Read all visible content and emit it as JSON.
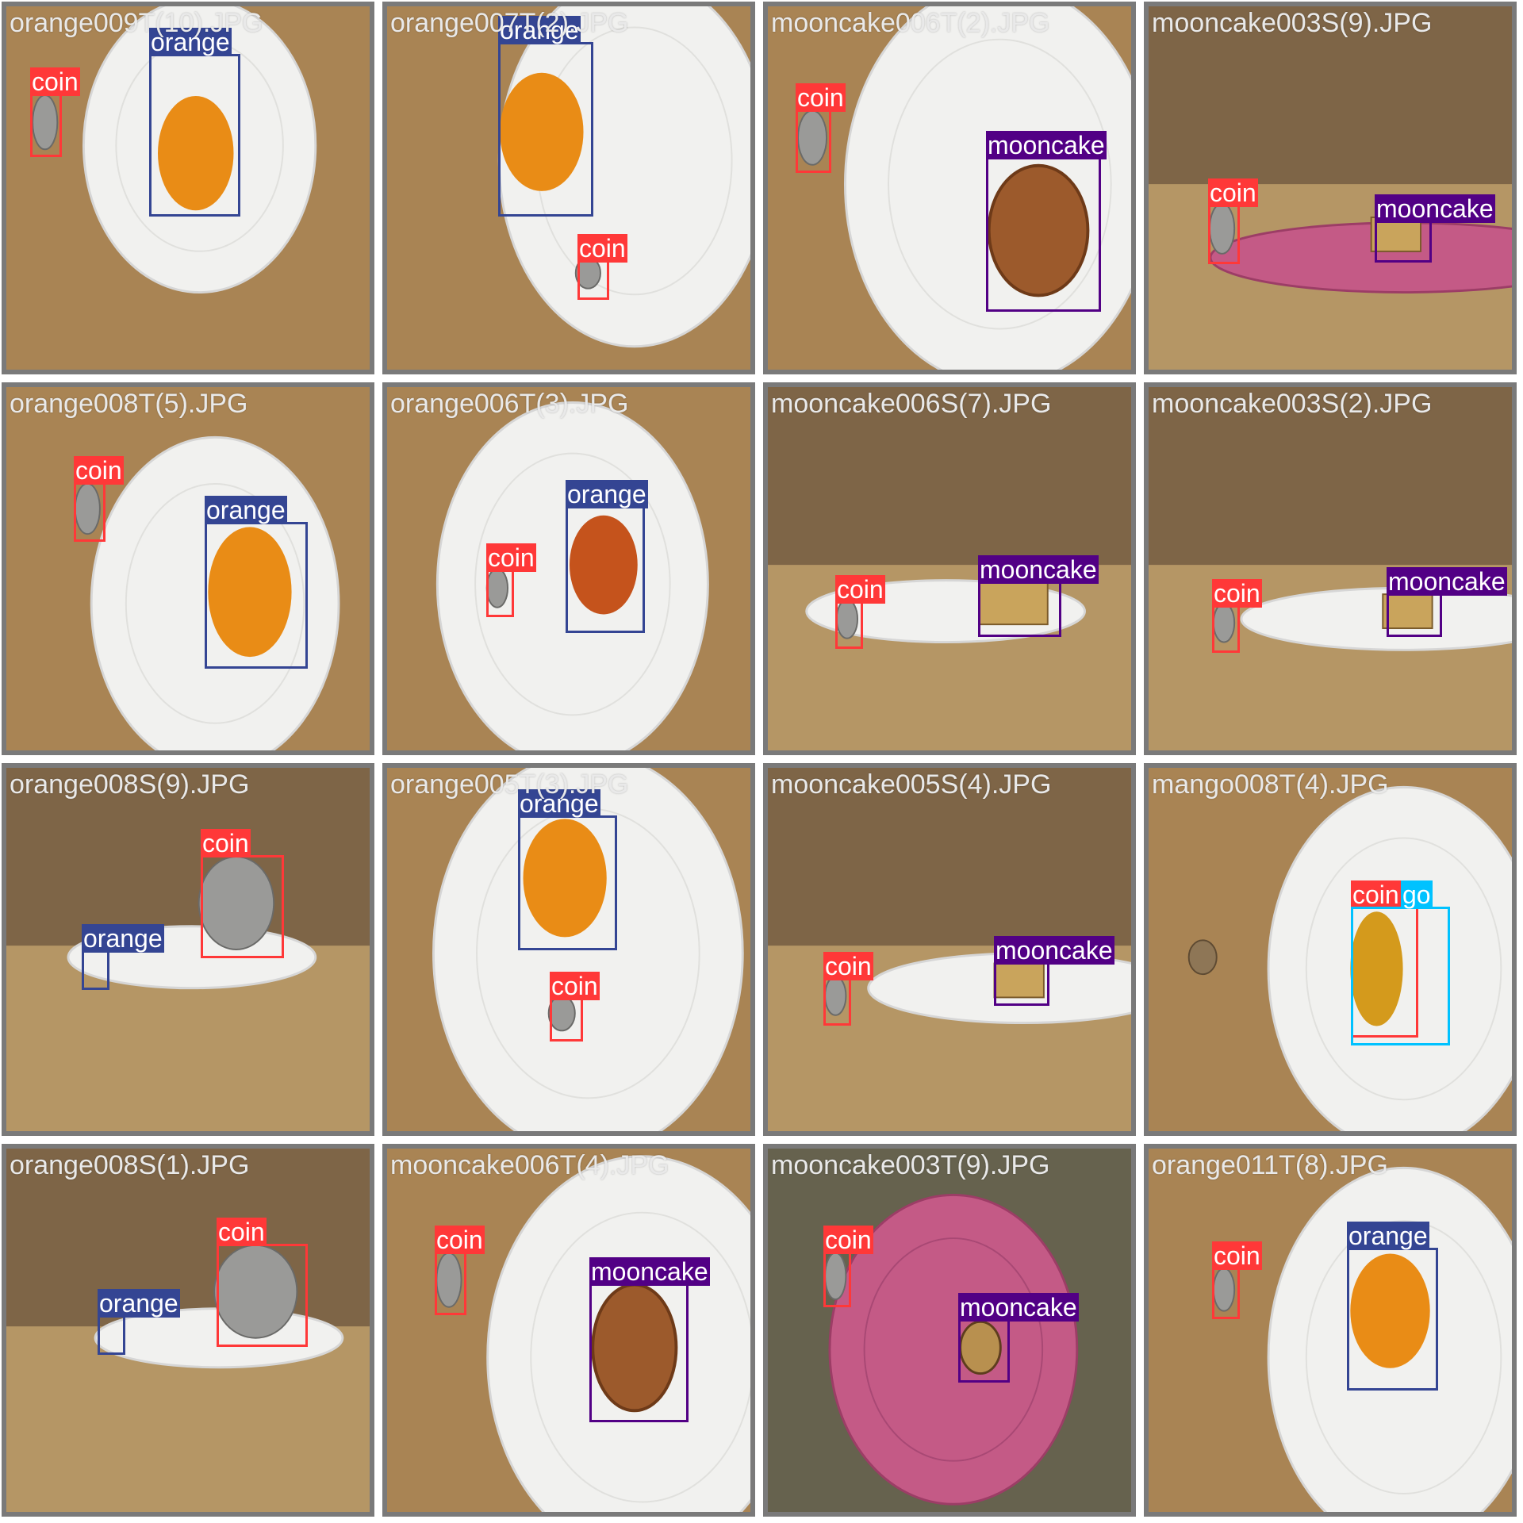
{
  "colors": {
    "coin": "#ff3838",
    "orange": "#344593",
    "mooncake": "#520085",
    "mango": "#00c2ff"
  },
  "tiles": [
    {
      "title": "orange009T(10).JPG",
      "scene": "plate-top-white",
      "dets": [
        {
          "label": "coin",
          "cls": "coin"
        },
        {
          "label": "orange",
          "cls": "orange"
        }
      ]
    },
    {
      "title": "orange007T(2).JPG",
      "scene": "plate-top-white",
      "dets": [
        {
          "label": "orange",
          "cls": "orange"
        },
        {
          "label": "coin",
          "cls": "coin"
        }
      ]
    },
    {
      "title": "mooncake006T(2).JPG",
      "scene": "plate-top-white",
      "dets": [
        {
          "label": "coin",
          "cls": "coin"
        },
        {
          "label": "mooncake",
          "cls": "mooncake"
        }
      ]
    },
    {
      "title": "mooncake003S(9).JPG",
      "scene": "plate-side-pink",
      "dets": [
        {
          "label": "coin",
          "cls": "coin"
        },
        {
          "label": "mooncake",
          "cls": "mooncake"
        }
      ]
    },
    {
      "title": "orange008T(5).JPG",
      "scene": "plate-top-white",
      "dets": [
        {
          "label": "coin",
          "cls": "coin"
        },
        {
          "label": "orange",
          "cls": "orange"
        }
      ]
    },
    {
      "title": "orange006T(3).JPG",
      "scene": "plate-top-white",
      "dets": [
        {
          "label": "coin",
          "cls": "coin"
        },
        {
          "label": "orange",
          "cls": "orange"
        }
      ]
    },
    {
      "title": "mooncake006S(7).JPG",
      "scene": "plate-side-white",
      "dets": [
        {
          "label": "coin",
          "cls": "coin"
        },
        {
          "label": "mooncake",
          "cls": "mooncake"
        }
      ]
    },
    {
      "title": "mooncake003S(2).JPG",
      "scene": "plate-side-white",
      "dets": [
        {
          "label": "coin",
          "cls": "coin"
        },
        {
          "label": "mooncake",
          "cls": "mooncake"
        }
      ]
    },
    {
      "title": "orange008S(9).JPG",
      "scene": "plate-side-white",
      "dets": [
        {
          "label": "orange",
          "cls": "orange"
        },
        {
          "label": "coin",
          "cls": "coin"
        }
      ]
    },
    {
      "title": "orange005T(3).JPG",
      "scene": "plate-top-white",
      "dets": [
        {
          "label": "orange",
          "cls": "orange"
        },
        {
          "label": "coin",
          "cls": "coin"
        }
      ]
    },
    {
      "title": "mooncake005S(4).JPG",
      "scene": "plate-side-white",
      "dets": [
        {
          "label": "coin",
          "cls": "coin"
        },
        {
          "label": "mooncake",
          "cls": "mooncake"
        }
      ]
    },
    {
      "title": "mango008T(4).JPG",
      "scene": "plate-top-white",
      "dets": [
        {
          "label": "coin",
          "cls": "coin"
        },
        {
          "label": "go",
          "cls": "mango"
        }
      ]
    },
    {
      "title": "orange008S(1).JPG",
      "scene": "plate-side-white",
      "dets": [
        {
          "label": "orange",
          "cls": "orange"
        },
        {
          "label": "coin",
          "cls": "coin"
        }
      ]
    },
    {
      "title": "mooncake006T(4).JPG",
      "scene": "plate-top-white",
      "dets": [
        {
          "label": "coin",
          "cls": "coin"
        },
        {
          "label": "mooncake",
          "cls": "mooncake"
        }
      ]
    },
    {
      "title": "mooncake003T(9).JPG",
      "scene": "plate-top-pink",
      "dets": [
        {
          "label": "coin",
          "cls": "coin"
        },
        {
          "label": "mooncake",
          "cls": "mooncake"
        }
      ]
    },
    {
      "title": "orange011T(8).JPG",
      "scene": "plate-top-white",
      "dets": [
        {
          "label": "coin",
          "cls": "coin"
        },
        {
          "label": "orange",
          "cls": "orange"
        }
      ]
    }
  ]
}
